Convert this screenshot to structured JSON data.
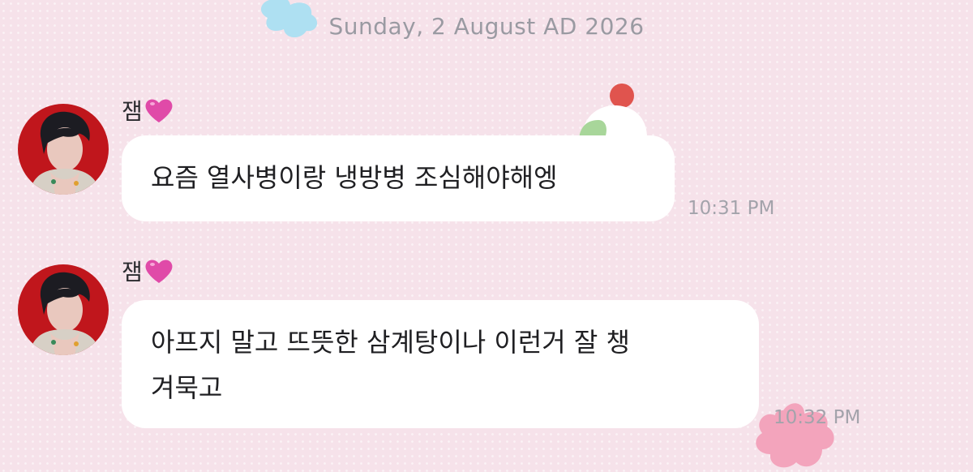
{
  "date_separator": "Sunday, 2 August AD 2026",
  "messages": [
    {
      "sender": "잼",
      "sender_emoji": "💗",
      "text_lines": [
        "요즘 열사병이랑 냉방병 조심해야해엥"
      ],
      "time": "10:31 PM"
    },
    {
      "sender": "잼",
      "sender_emoji": "💗",
      "text_lines": [
        "아프지 말고 뜨뜻한 삼계탕이나 이런거 잘 챙",
        "겨묵고"
      ],
      "time": "10:32 PM"
    }
  ],
  "colors": {
    "background": "#f6e2ea",
    "bubble": "#ffffff",
    "heart": "#e04aa8",
    "avatar_bg": "#c0161c"
  },
  "icons": {
    "sender_heart": "heart-icon",
    "avatar": "profile-photo"
  }
}
